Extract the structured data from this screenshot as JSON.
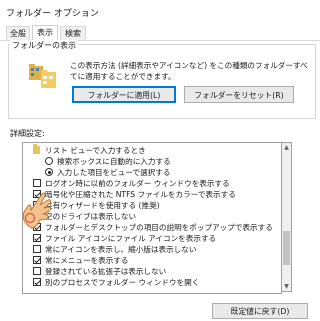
{
  "window": {
    "title": "フォルダー オプション"
  },
  "tabs": [
    {
      "label": "全般"
    },
    {
      "label": "表示"
    },
    {
      "label": "検索"
    }
  ],
  "folder_view": {
    "group_label": "フォルダーの表示",
    "description_line1": "この表示方法 (詳細表示やアイコンなど) をこの種類のフォルダーすべ",
    "description_line2": "てに適用することができます。",
    "apply_button": "フォルダーに適用(L)",
    "reset_button": "フォルダーをリセット(R)"
  },
  "advanced": {
    "label": "詳細設定:",
    "items": [
      {
        "type": "folder",
        "label": "リスト ビューで入力するとき"
      },
      {
        "type": "radio",
        "selected": false,
        "label": "検索ボックスに自動的に入力する"
      },
      {
        "type": "radio",
        "selected": true,
        "label": "入力した項目をビューで選択する"
      },
      {
        "type": "checkbox",
        "checked": false,
        "label": "ログオン時に以前のフォルダー ウィンドウを表示する"
      },
      {
        "type": "checkbox",
        "checked": true,
        "label": "暗号化や圧縮された NTFS ファイルをカラーで表示する"
      },
      {
        "type": "checkbox",
        "checked": true,
        "label": "共有ウィザードを使用する (推奨)"
      },
      {
        "type": "checkbox",
        "checked": true,
        "label": "空のドライブは表示しない"
      },
      {
        "type": "checkbox",
        "checked": true,
        "label": "フォルダーとデスクトップの項目の説明をポップアップで表示する"
      },
      {
        "type": "checkbox",
        "checked": true,
        "label": "ファイル アイコンにファイル アイコンを表示する"
      },
      {
        "type": "checkbox",
        "checked": false,
        "label": "常にアイコンを表示し、縮小版は表示しない"
      },
      {
        "type": "checkbox",
        "checked": true,
        "label": "常にメニューを表示する"
      },
      {
        "type": "checkbox",
        "checked": false,
        "label": "登録されている拡張子は表示しない"
      },
      {
        "type": "checkbox",
        "checked": true,
        "label": "別のプロセスでフォルダー ウィンドウを開く"
      }
    ]
  },
  "restore_button": "既定値に戻す(D)"
}
